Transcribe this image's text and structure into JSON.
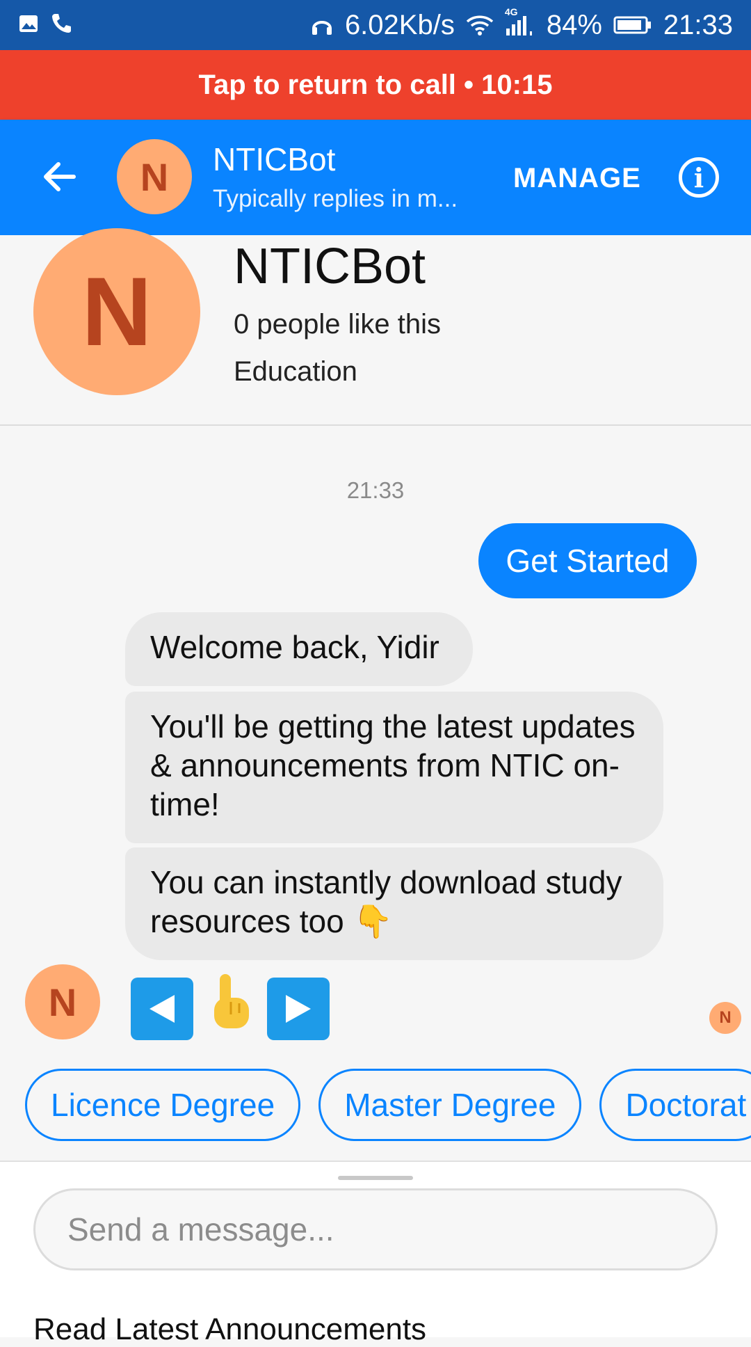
{
  "status_bar": {
    "net_speed": "6.02Kb/s",
    "network_type": "4G",
    "battery": "84%",
    "time": "21:33"
  },
  "call_banner": {
    "text": "Tap to return to call • 10:15"
  },
  "header": {
    "avatar_letter": "N",
    "title": "NTICBot",
    "subtitle": "Typically replies in m...",
    "manage_label": "MANAGE",
    "info_glyph": "i"
  },
  "profile": {
    "avatar_letter": "N",
    "name": "NTICBot",
    "likes": "0 people like this",
    "category": "Education"
  },
  "chat": {
    "timestamp": "21:33",
    "sent": {
      "text": "Get Started"
    },
    "received": [
      {
        "text": "Welcome back, Yidir"
      },
      {
        "text": "You'll be getting the latest updates & announcements from NTIC on-time!"
      },
      {
        "text": "You can instantly download study resources too 👇"
      }
    ],
    "avatar_letter": "N",
    "emoji_message": [
      "◀",
      "👆",
      "▶"
    ],
    "seen_letter": "N"
  },
  "quick_replies": [
    "Licence Degree",
    "Master Degree",
    "Doctorat"
  ],
  "composer": {
    "placeholder": "Send a message...",
    "menu_items": [
      "Read Latest Announcements"
    ]
  },
  "colors": {
    "status_bar": "#1558a8",
    "call_banner": "#ee412c",
    "header": "#0a84ff",
    "avatar_bg": "#ffab73",
    "avatar_text": "#b6441f"
  }
}
